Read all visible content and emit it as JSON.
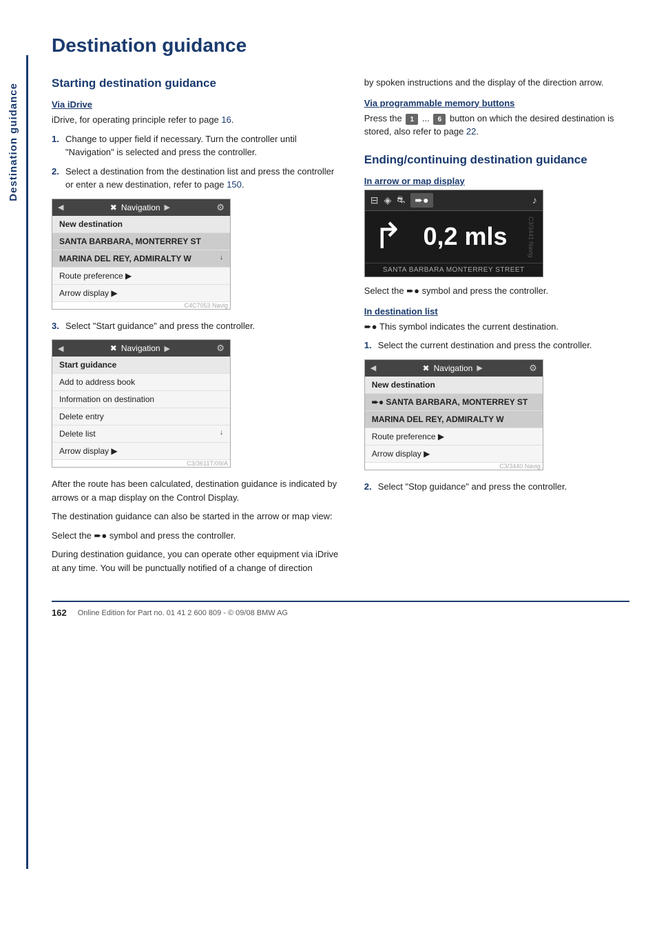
{
  "sidebar": {
    "text": "Destination guidance",
    "line_color": "#1a3a6e"
  },
  "page": {
    "title": "Destination guidance",
    "footer_page": "162",
    "footer_text": "Online Edition for Part no. 01 41 2 600 809 - © 09/08 BMW AG"
  },
  "left_col": {
    "section_heading": "Starting destination guidance",
    "via_idrive_heading": "Via iDrive",
    "via_idrive_para": "iDrive, for operating principle refer to page 16.",
    "step1": "Change to upper field if necessary. Turn the controller until \"Navigation\" is selected and press the controller.",
    "step2": "Select a destination from the destination list and press the controller or enter a new destination, refer to page 150.",
    "step3": "Select \"Start guidance\" and press the controller.",
    "nav_menu1": {
      "header_left": "◀",
      "header_nav": "Navigation",
      "header_right": "▶",
      "header_gear": "⚙",
      "items": [
        {
          "label": "New destination",
          "style": "selected"
        },
        {
          "label": "SANTA BARBARA, MONTERREY ST",
          "style": "dark"
        },
        {
          "label": "MARINA DEL REY, ADMIRALTY W",
          "style": "dark",
          "has_scroll": true
        },
        {
          "label": "Route preference ▶",
          "style": "normal"
        },
        {
          "label": "Arrow display ▶",
          "style": "normal"
        }
      ],
      "credit": "C4C7053 Navig"
    },
    "nav_menu2": {
      "header_left": "◀",
      "header_nav": "Navigation",
      "header_right": "▶",
      "header_gear": "⚙",
      "items": [
        {
          "label": "Start guidance",
          "style": "selected"
        },
        {
          "label": "Add to address book",
          "style": "normal"
        },
        {
          "label": "Information on destination",
          "style": "normal"
        },
        {
          "label": "Delete entry",
          "style": "normal"
        },
        {
          "label": "Delete list",
          "style": "normal"
        },
        {
          "label": "Arrow display ▶",
          "style": "normal"
        }
      ],
      "credit": "C3/3611T/09/A"
    },
    "after_calc_para1": "After the route has been calculated, destination guidance is indicated by arrows or a map display on the Control Display.",
    "after_calc_para2": "The destination guidance can also be started in the arrow or map view:",
    "after_calc_para3": "Select the ➨● symbol and press the controller.",
    "after_calc_para4": "During destination guidance, you can operate other equipment via iDrive at any time. You will be punctually notified of a change of direction"
  },
  "right_col": {
    "right_para1": "by spoken instructions and the display of the direction arrow.",
    "via_prog_heading": "Via programmable memory buttons",
    "via_prog_para_prefix": "Press the",
    "mem_btn1": "1",
    "via_prog_para_middle": " ... ",
    "mem_btn2": "6",
    "via_prog_para_suffix": " button on which the desired destination is stored, also refer to page 22.",
    "ending_section_heading": "Ending/continuing destination guidance",
    "in_arrow_heading": "In arrow or map display",
    "arrow_display": {
      "toolbar_icons": [
        "⊟",
        "◈",
        "⛐",
        "➨●"
      ],
      "active_icon": "➨●",
      "arrow_symbol": "↑",
      "corner": "↱",
      "distance": "0,2 mls",
      "street": "SANTA BARBARA MONTERREY STREET",
      "credit": "C3/3441 Navig"
    },
    "select_symbol_para": "Select the ➨● symbol and press the controller.",
    "in_dest_list_heading": "In destination list",
    "dest_list_bullet": "➨● This symbol indicates the current destination.",
    "dest_list_step1": "Select the current destination and press the controller.",
    "nav_menu3": {
      "header_left": "◀",
      "header_nav": "Navigation",
      "header_right": "▶",
      "header_gear": "⚙",
      "items": [
        {
          "label": "New destination",
          "style": "selected"
        },
        {
          "label": "➨● SANTA BARBARA, MONTERREY ST",
          "style": "dark"
        },
        {
          "label": "MARINA DEL REY, ADMIRALTY W",
          "style": "dark"
        },
        {
          "label": "Route preference ▶",
          "style": "normal"
        },
        {
          "label": "Arrow display ▶",
          "style": "normal"
        }
      ],
      "credit": "C3/3440 Navig"
    },
    "dest_list_step2": "Select \"Stop guidance\" and press the controller."
  }
}
